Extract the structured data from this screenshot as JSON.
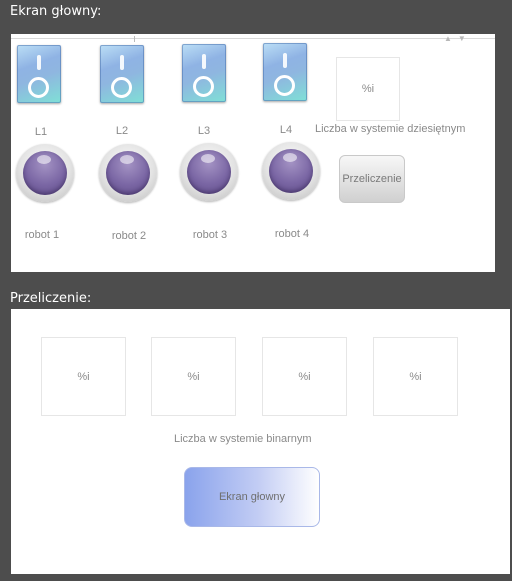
{
  "main_screen": {
    "header": "Ekran głowny:",
    "switches": [
      {
        "label": "L1",
        "state": "on"
      },
      {
        "label": "L2",
        "state": "on"
      },
      {
        "label": "L3",
        "state": "on"
      },
      {
        "label": "L4",
        "state": "on"
      }
    ],
    "robots": [
      {
        "label": "robot 1"
      },
      {
        "label": "robot 2"
      },
      {
        "label": "robot 3"
      },
      {
        "label": "robot 4"
      }
    ],
    "decimal_display": "%i",
    "decimal_caption": "Liczba w systemie dziesiętnym",
    "convert_button": "Przeliczenie"
  },
  "conversion_screen": {
    "header": "Przeliczenie:",
    "binary_digits": [
      "%i",
      "%i",
      "%i",
      "%i"
    ],
    "binary_caption": "Liczba w systemie binarnym",
    "back_button": "Ekran głowny"
  },
  "colors": {
    "background": "#4d4d4d",
    "panel": "#ffffff",
    "switch_accent": "#8fb3e4",
    "knob_accent": "#7a66a4",
    "back_button_accent": "#8aa3ec"
  }
}
